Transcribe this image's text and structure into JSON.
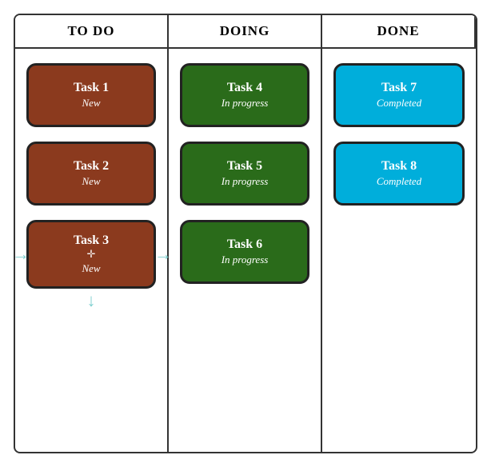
{
  "board": {
    "columns": [
      {
        "id": "todo",
        "header": "TO DO",
        "tasks": [
          {
            "id": "task1",
            "title": "Task 1",
            "status": "New",
            "style": "card-todo"
          },
          {
            "id": "task2",
            "title": "Task 2",
            "status": "New",
            "style": "card-todo"
          },
          {
            "id": "task3",
            "title": "Task 3",
            "status": "New",
            "style": "card-todo",
            "hasArrows": true
          }
        ]
      },
      {
        "id": "doing",
        "header": "DOING",
        "tasks": [
          {
            "id": "task4",
            "title": "Task 4",
            "status": "In progress",
            "style": "card-doing"
          },
          {
            "id": "task5",
            "title": "Task 5",
            "status": "In progress",
            "style": "card-doing"
          },
          {
            "id": "task6",
            "title": "Task 6",
            "status": "In progress",
            "style": "card-doing"
          }
        ]
      },
      {
        "id": "done",
        "header": "DONE",
        "tasks": [
          {
            "id": "task7",
            "title": "Task 7",
            "status": "Completed",
            "style": "card-done"
          },
          {
            "id": "task8",
            "title": "Task 8",
            "status": "Completed",
            "style": "card-done"
          }
        ]
      }
    ]
  }
}
